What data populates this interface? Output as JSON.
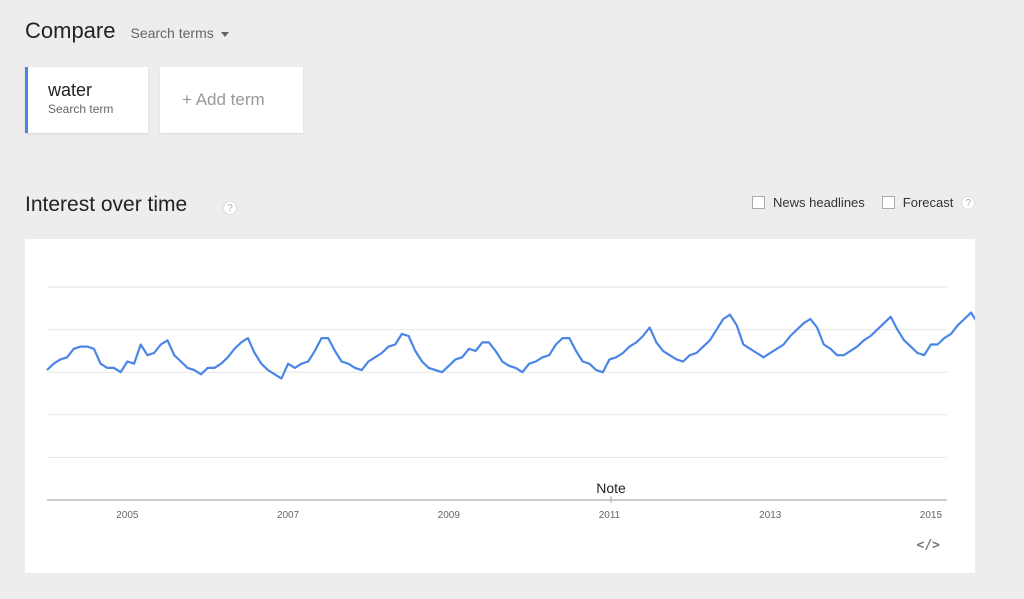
{
  "header": {
    "title": "Compare",
    "dropdown_label": "Search terms"
  },
  "terms": [
    {
      "name": "water",
      "type_label": "Search term",
      "color": "#4a86e8"
    }
  ],
  "add_term_label": "+ Add term",
  "section": {
    "title": "Interest over time",
    "help_glyph": "?"
  },
  "options": {
    "news_label": "News headlines",
    "forecast_label": "Forecast",
    "help_glyph": "?"
  },
  "embed_glyph": "</>",
  "note_label": "Note",
  "chart_data": {
    "type": "line",
    "x_start": 2004.0,
    "x_step": 0.08333,
    "x_ticks": [
      "2005",
      "2007",
      "2009",
      "2011",
      "2013",
      "2015"
    ],
    "series": [
      {
        "color": "#4a86e8",
        "values": [
          61,
          64,
          66,
          67,
          71,
          72,
          72,
          71,
          64,
          62,
          62,
          60,
          65,
          64,
          73,
          68,
          69,
          73,
          75,
          68,
          65,
          62,
          61,
          59,
          62,
          62,
          64,
          67,
          71,
          74,
          76,
          69,
          64,
          61,
          59,
          57,
          64,
          62,
          64,
          65,
          70,
          76,
          76,
          70,
          65,
          64,
          62,
          61,
          65,
          67,
          69,
          72,
          73,
          78,
          77,
          70,
          65,
          62,
          61,
          60,
          63,
          66,
          67,
          71,
          70,
          74,
          74,
          70,
          65,
          63,
          62,
          60,
          64,
          65,
          67,
          68,
          73,
          76,
          76,
          70,
          65,
          64,
          61,
          60,
          66,
          67,
          69,
          72,
          74,
          77,
          81,
          74,
          70,
          68,
          66,
          65,
          68,
          69,
          72,
          75,
          80,
          85,
          87,
          82,
          73,
          71,
          69,
          67,
          69,
          71,
          73,
          77,
          80,
          83,
          85,
          81,
          73,
          71,
          68,
          68,
          70,
          72,
          75,
          77,
          80,
          83,
          86,
          80,
          75,
          72,
          69,
          68,
          73,
          73,
          76,
          78,
          82,
          85,
          88,
          83,
          77,
          75,
          72,
          72,
          74,
          78,
          82
        ]
      }
    ]
  }
}
